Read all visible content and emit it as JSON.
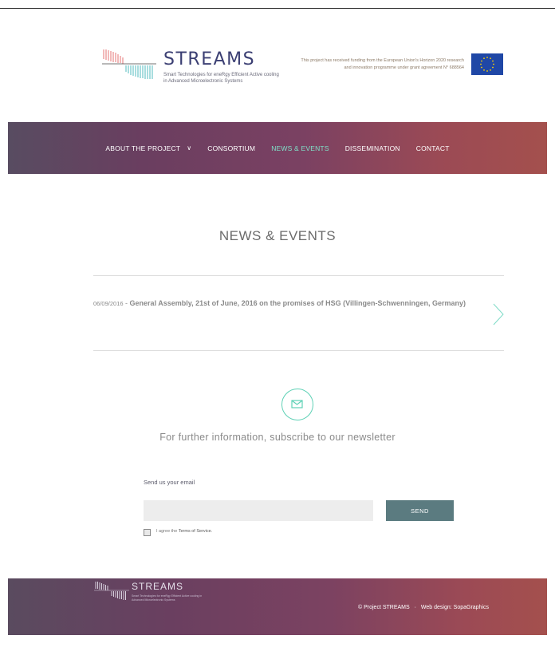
{
  "header": {
    "logo_title": "STREAMS",
    "logo_subtitle": "Smart Technologies for eneRgy Efficient Active cooling in Advanced Microelectronic Systems",
    "eu_text": "This project has received funding from the European Union's Horizon 2020 research and innovation programme under grant agreement N° 688564"
  },
  "nav": {
    "items": [
      {
        "label": "ABOUT THE PROJECT"
      },
      {
        "label": "CONSORTIUM"
      },
      {
        "label": "NEWS & EVENTS"
      },
      {
        "label": "DISSEMINATION"
      },
      {
        "label": "CONTACT"
      }
    ],
    "dropdown_glyph": "∨"
  },
  "main": {
    "section_title": "NEWS & EVENTS",
    "news": [
      {
        "date": "06/09/2016",
        "separator": " - ",
        "title": "General Assembly, 21st of June, 2016 on the promises of HSG (Villingen-Schwenningen, Germany)"
      }
    ]
  },
  "newsletter": {
    "heading": "For further information, subscribe to our newsletter",
    "email_label": "Send us your email",
    "email_value": "",
    "send_label": "SEND",
    "agree_prefix": "I agree the ",
    "agree_link": "Terms of Service",
    "agree_suffix": "."
  },
  "footer": {
    "logo_title": "STREAMS",
    "logo_subtitle": "Smart Technologies for eneRgy Efficient Active cooling in Advanced Microelectronic Systems",
    "copyright": "© Project STREAMS",
    "separator": "·",
    "design_credit": "Web design: SopaGraphics"
  },
  "colors": {
    "accent": "#7fe0c8",
    "brand_navy": "#3b3f73",
    "send_button": "#5b7b80",
    "eu_blue": "#1f47a6",
    "eu_star": "#ffd200"
  },
  "icons": {
    "logo": "streams-logo-icon",
    "eu_flag": "eu-flag-icon",
    "news_arrow": "chevron-right-icon",
    "newsletter": "envelope-icon",
    "checkbox": "checkbox-icon"
  }
}
